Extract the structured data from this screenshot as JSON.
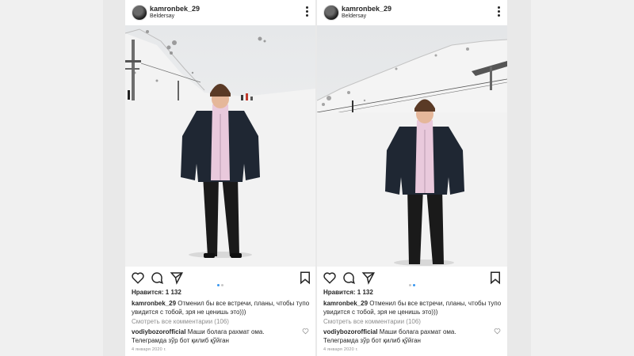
{
  "posts": [
    {
      "username": "kamronbek_29",
      "location": "Beldersay",
      "likes": "Нравится: 1 132",
      "caption_user": "kamronbek_29",
      "caption_text": "Отменил бы все встречи, планы, чтобы тупо увидится с тобой, зря не ценишь это)))",
      "view_all": "Смотреть все комментарии (106)",
      "comment_user": "vodiybozorofficial",
      "comment_text": "Маши болага рахмат ома. Телеграмда зўр бот қилиб қўйган",
      "date": "4 января 2020 г."
    },
    {
      "username": "kamronbek_29",
      "location": "Beldersay",
      "likes": "Нравится: 1 132",
      "caption_user": "kamronbek_29",
      "caption_text": "Отменил бы все встречи, планы, чтобы тупо увидится с тобой, зря не ценишь это)))",
      "view_all": "Смотреть все комментарии (106)",
      "comment_user": "vodiybozorofficial",
      "comment_text": "Маши болага рахмат ома. Телеграмда зўр бот қилиб қўйган",
      "date": "4 января 2020 г."
    }
  ],
  "icons": {
    "like": "heart-icon",
    "comment": "comment-icon",
    "share": "send-icon",
    "save": "bookmark-icon",
    "more": "more-options-icon"
  },
  "colors": {
    "link": "#3897f0",
    "muted": "#8e8e8e",
    "text": "#262626",
    "jacket": "#1f2733",
    "hoodie": "#e9c9dc",
    "beanie": "#5a3a26"
  }
}
